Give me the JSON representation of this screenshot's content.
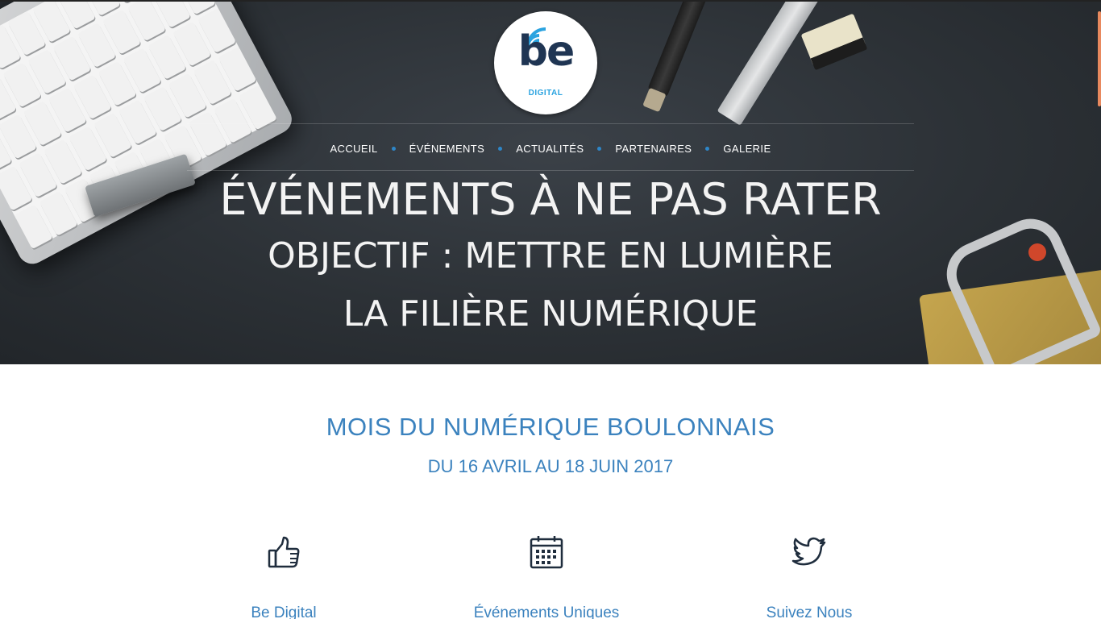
{
  "logo": {
    "main": "be",
    "sub": "DIGITAL"
  },
  "nav": {
    "items": [
      "ACCUEIL",
      "ÉVÉNEMENTS",
      "ACTUALITÉS",
      "PARTENAIRES",
      "GALERIE"
    ]
  },
  "hero": {
    "line1": "ÉVÉNEMENTS À NE PAS RATER",
    "line2": "OBJECTIF : METTRE EN LUMIÈRE",
    "line3": "LA FILIÈRE NUMÉRIQUE"
  },
  "section": {
    "title": "MOIS DU NUMÉRIQUE BOULONNAIS",
    "subtitle": "DU 16 AVRIL AU 18 JUIN 2017"
  },
  "features": [
    {
      "label": "Be Digital",
      "icon": "thumbs-up-icon"
    },
    {
      "label": "Événements Uniques",
      "icon": "calendar-icon"
    },
    {
      "label": "Suivez Nous",
      "icon": "twitter-icon"
    }
  ],
  "colors": {
    "accent": "#3b82be",
    "nav_dot": "#2e86c8",
    "logo_text": "#1f3553",
    "logo_sub": "#2aa3e0"
  }
}
